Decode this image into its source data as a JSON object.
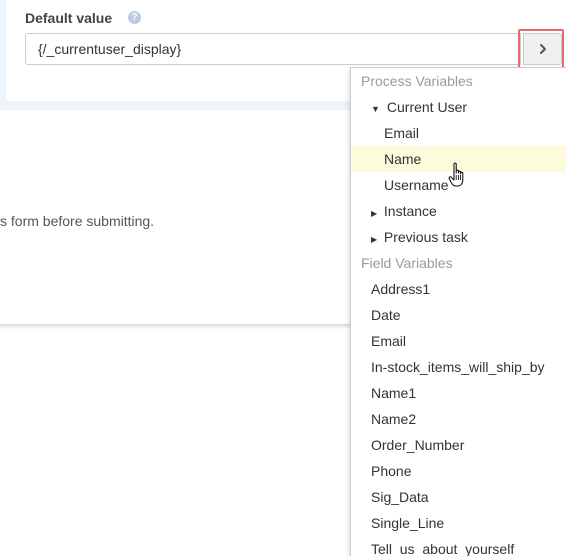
{
  "field": {
    "label": "Default value",
    "help_glyph": "?",
    "value": "{/_currentuser_display}"
  },
  "picker_button": {
    "icon": "chevron-right-icon",
    "glyph": "›",
    "highlight_color": "#e36b6b"
  },
  "form_hint": "s form before submitting.",
  "menu": {
    "process_header": "Process Variables",
    "current_user": {
      "label": "Current User",
      "expanded": true,
      "caret": "▼"
    },
    "current_user_items": [
      "Email",
      "Name",
      "Username"
    ],
    "hovered_item": "Name",
    "instance": {
      "label": "Instance",
      "caret": "▶"
    },
    "previous_task": {
      "label": "Previous task",
      "caret": "▶"
    },
    "field_header": "Field Variables",
    "field_items": [
      "Address1",
      "Date",
      "Email",
      "In-stock_items_will_ship_by",
      "Name1",
      "Name2",
      "Order_Number",
      "Phone",
      "Sig_Data",
      "Single_Line",
      "Tell_us_about_yourself"
    ]
  },
  "colors": {
    "panel_bg": "#eef4fb",
    "hover_bg": "#fdfbdb",
    "header_text": "#9a9a9a"
  }
}
